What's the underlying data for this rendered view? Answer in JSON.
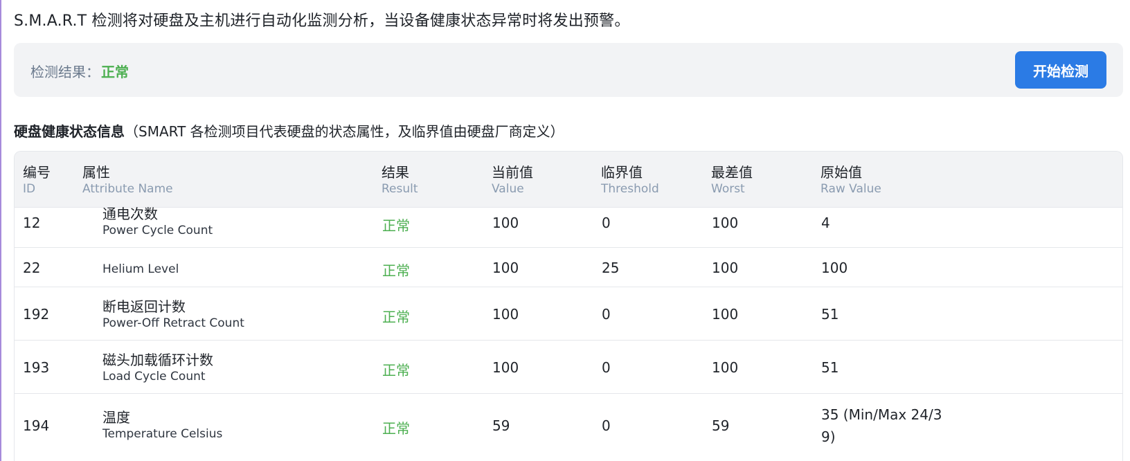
{
  "intro": "S.M.A.R.T 检测将对硬盘及主机进行自动化监测分析，当设备健康状态异常时将发出预警。",
  "result_bar": {
    "label": "检测结果：",
    "value": "正常",
    "button": "开始检测"
  },
  "section": {
    "title": "硬盘健康状态信息",
    "note": "（SMART 各检测项目代表硬盘的状态属性，及临界值由硬盘厂商定义）"
  },
  "table": {
    "headers": [
      {
        "cn": "编号",
        "en": "ID"
      },
      {
        "cn": "属性",
        "en": "Attribute Name"
      },
      {
        "cn": "结果",
        "en": "Result"
      },
      {
        "cn": "当前值",
        "en": "Value"
      },
      {
        "cn": "临界值",
        "en": "Threshold"
      },
      {
        "cn": "最差值",
        "en": "Worst"
      },
      {
        "cn": "原始值",
        "en": "Raw Value"
      }
    ],
    "rows": [
      {
        "id": "12",
        "attr_cn": "通电次数",
        "attr_en": "Power Cycle Count",
        "result": "正常",
        "value": "100",
        "threshold": "0",
        "worst": "100",
        "raw": "4"
      },
      {
        "id": "22",
        "attr_cn": "",
        "attr_en": "Helium Level",
        "result": "正常",
        "value": "100",
        "threshold": "25",
        "worst": "100",
        "raw": "100"
      },
      {
        "id": "192",
        "attr_cn": "断电返回计数",
        "attr_en": "Power-Off Retract Count",
        "result": "正常",
        "value": "100",
        "threshold": "0",
        "worst": "100",
        "raw": "51"
      },
      {
        "id": "193",
        "attr_cn": "磁头加载循环计数",
        "attr_en": "Load Cycle Count",
        "result": "正常",
        "value": "100",
        "threshold": "0",
        "worst": "100",
        "raw": "51"
      },
      {
        "id": "194",
        "attr_cn": "温度",
        "attr_en": "Temperature Celsius",
        "result": "正常",
        "value": "59",
        "threshold": "0",
        "worst": "59",
        "raw": "35 (Min/Max 24/39)"
      }
    ]
  },
  "colors": {
    "accent": "#2b7be5",
    "ok": "#4caf50",
    "panel": "#f2f3f5"
  }
}
